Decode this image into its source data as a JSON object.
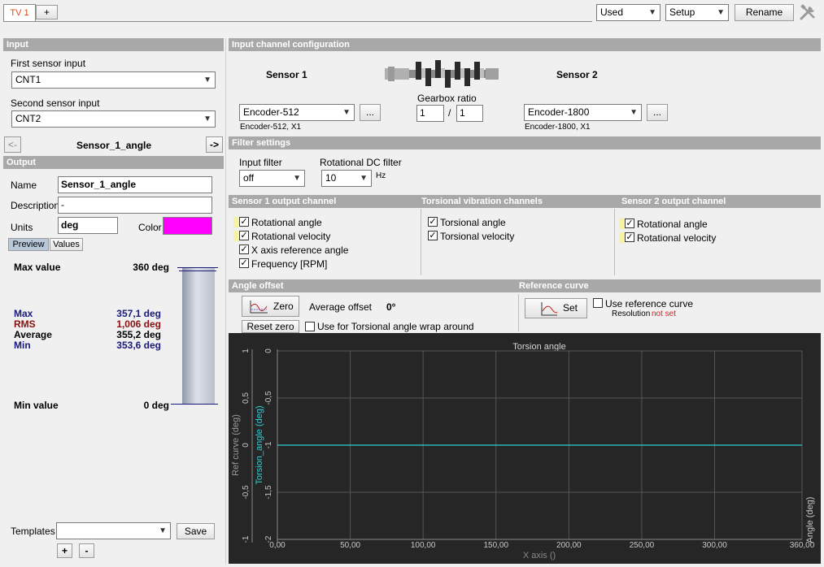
{
  "tabs": {
    "active": "TV 1",
    "add": "+"
  },
  "toolbar": {
    "used": "Used",
    "setup": "Setup",
    "rename": "Rename",
    "tools_icon": "tools-icon"
  },
  "input": {
    "header": "Input",
    "first_label": "First sensor input",
    "first_value": "CNT1",
    "second_label": "Second sensor input",
    "second_value": "CNT2",
    "prev": "<-",
    "next": "->",
    "channel": "Sensor_1_angle"
  },
  "output": {
    "header": "Output",
    "name_label": "Name",
    "name_value": "Sensor_1_angle",
    "desc_label": "Description",
    "desc_value": "-",
    "units_label": "Units",
    "units_value": "deg",
    "color_label": "Color",
    "color_value": "#ff00ff",
    "tab_preview": "Preview",
    "tab_values": "Values",
    "max_value_label": "Max value",
    "max_value": "360 deg",
    "stats": [
      {
        "label": "Max",
        "value": "357,1 deg",
        "color": "#1a1a7a"
      },
      {
        "label": "RMS",
        "value": "1,006 deg",
        "color": "#8a1010"
      },
      {
        "label": "Average",
        "value": "355,2 deg",
        "color": "#000000"
      },
      {
        "label": "Min",
        "value": "353,6 deg",
        "color": "#1a1a7a"
      }
    ],
    "min_value_label": "Min value",
    "min_value": "0 deg",
    "templates_label": "Templates",
    "save": "Save",
    "plus": "+",
    "minus": "-"
  },
  "config": {
    "header": "Input channel configuration",
    "sensor1": "Sensor 1",
    "sensor2": "Sensor 2",
    "gearbox_label": "Gearbox ratio",
    "gear_a": "1",
    "gear_sep": "/",
    "gear_b": "1",
    "enc1": "Encoder-512",
    "enc1_sub": "Encoder-512, X1",
    "enc2": "Encoder-1800",
    "enc2_sub": "Encoder-1800, X1",
    "more": "..."
  },
  "filter": {
    "header": "Filter settings",
    "input_label": "Input filter",
    "input_value": "off",
    "dc_label": "Rotational DC filter",
    "dc_value": "10",
    "dc_unit": "Hz"
  },
  "s1out": {
    "header": "Sensor 1 output channel",
    "items": [
      "Rotational angle",
      "Rotational velocity",
      "X axis reference angle",
      "Frequency [RPM]"
    ]
  },
  "torsional": {
    "header": "Torsional vibration channels",
    "items": [
      "Torsional angle",
      "Torsional velocity"
    ]
  },
  "s2out": {
    "header": "Sensor 2 output channel",
    "items": [
      "Rotational angle",
      "Rotational velocity"
    ]
  },
  "angle": {
    "header": "Angle offset",
    "zero": "Zero",
    "avg_label": "Average offset",
    "avg_value": "0°",
    "reset": "Reset zero",
    "wrap": "Use for Torsional angle wrap around"
  },
  "ref": {
    "header": "Reference curve",
    "set": "Set",
    "use": "Use reference curve",
    "res_label": "Resolution",
    "res_value": "not set"
  },
  "chart_data": {
    "type": "line",
    "title": "Torsion angle",
    "xlabel": "X axis ()",
    "ylabel": "Torsion_angle (deg)",
    "ylabel_ref": "Ref curve (deg)",
    "ylabel_right": "Angle (deg)",
    "xlim": [
      0,
      360
    ],
    "x_ticks": [
      "0,00",
      "50,00",
      "100,00",
      "150,00",
      "200,00",
      "250,00",
      "300,00",
      "360,00"
    ],
    "y_ticks": [
      "0",
      "-0,5",
      "-1",
      "-1,5",
      "-2"
    ],
    "y_ref_ticks": [
      "1",
      "0,5",
      "0",
      "-0,5",
      "-1"
    ],
    "ylim": [
      -2,
      0
    ],
    "series": [
      {
        "values": [
          -1,
          -1
        ]
      }
    ],
    "x": [
      0,
      360
    ],
    "grid": true,
    "line_color": "#2fd0d8"
  }
}
